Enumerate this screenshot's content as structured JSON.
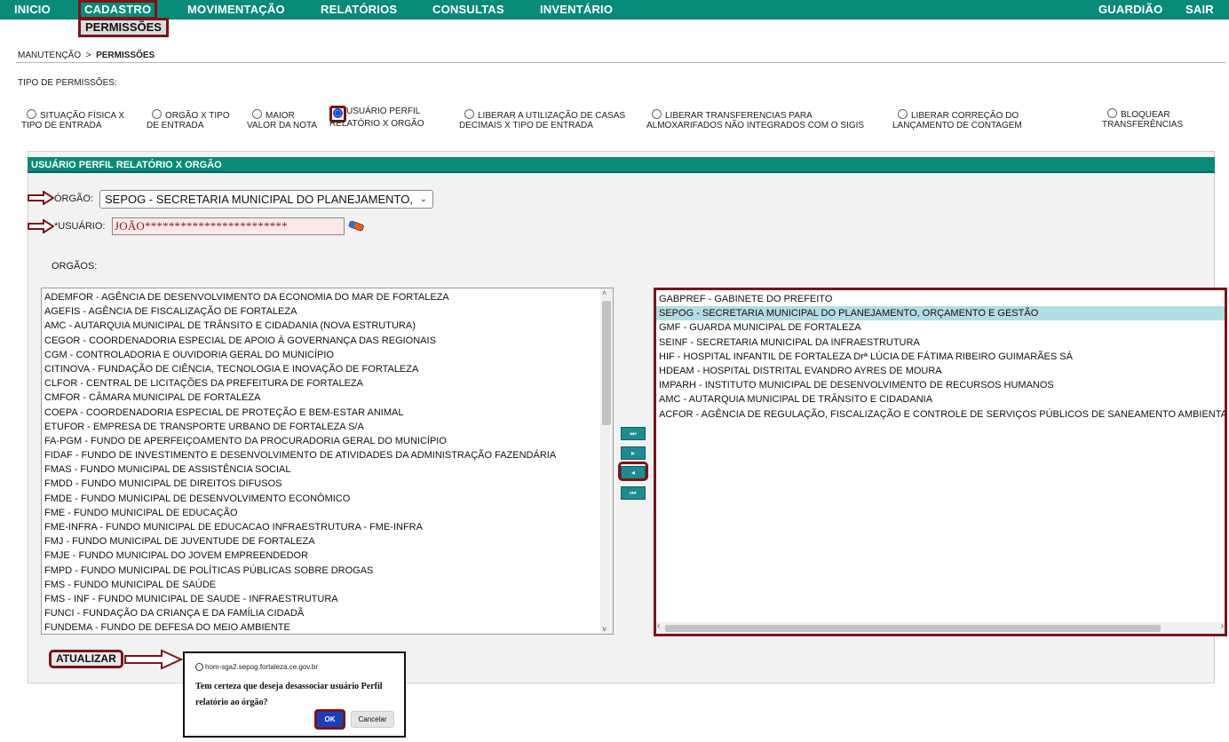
{
  "nav": {
    "items": [
      "INICIO",
      "CADASTRO",
      "MOVIMENTAÇÃO",
      "RELATÓRIOS",
      "CONSULTAS",
      "INVENTÁRIO"
    ],
    "right": [
      "GUARDIÃO",
      "SAIR"
    ],
    "submenu": "PERMISSÕES"
  },
  "breadcrumb": {
    "parent": "MANUTENÇÃO",
    "sep": ">",
    "current": "PERMISSÕES"
  },
  "permission_types_label": "TIPO DE PERMISSÕES:",
  "permission_types": [
    {
      "l1": "SITUAÇÃO FÍSICA X",
      "l2": "TIPO DE ENTRADA",
      "checked": false
    },
    {
      "l1": "ORGÃO X TIPO",
      "l2": "DE ENTRADA",
      "checked": false
    },
    {
      "l1": "MAIOR",
      "l2": "VALOR DA NOTA",
      "checked": false
    },
    {
      "l1": "USUÁRIO PERFIL",
      "l2": "RELATÓRIO X ORGÃO",
      "checked": true
    },
    {
      "l1": "LIBERAR A UTILIZAÇÃO DE CASAS",
      "l2": "DECIMAIS X TIPO DE ENTRADA",
      "checked": false
    },
    {
      "l1": "LIBERAR TRANSFERENCIAS PARA",
      "l2": "ALMOXARIFADOS NÃO INTEGRADOS COM O SIGIS",
      "checked": false
    },
    {
      "l1": "LIBERAR CORREÇÃO DO",
      "l2": "LANÇAMENTO DE CONTAGEM",
      "checked": false
    },
    {
      "l1": "BLOQUEAR",
      "l2": "TRANSFERÊNCIAS",
      "checked": false
    }
  ],
  "panel": {
    "title": "USUÁRIO PERFIL RELATÓRIO X ORGÃO",
    "orgao_label": "ÓRGÃO:",
    "orgao_value": "SEPOG - SECRETARIA MUNICIPAL DO PLANEJAMENTO,",
    "usuario_label": "*USUÁRIO:",
    "usuario_value": "JOÃO************************",
    "orgaos_label": "ORGÃOS:"
  },
  "available_orgaos": [
    "ADEMFOR - AGÊNCIA DE DESENVOLVIMENTO DA ECONOMIA DO MAR DE FORTALEZA",
    "AGEFIS - AGÊNCIA DE FISCALIZAÇÃO DE FORTALEZA",
    "AMC - AUTARQUIA MUNICIPAL DE TRÂNSITO E CIDADANIA (NOVA ESTRUTURA)",
    "CEGOR - COORDENADORIA ESPECIAL DE APOIO À GOVERNANÇA DAS REGIONAIS",
    "CGM - CONTROLADORIA E OUVIDORIA GERAL DO MUNICÍPIO",
    "CITINOVA - FUNDAÇÃO DE CIÊNCIA, TECNOLOGIA E INOVAÇÃO DE FORTALEZA",
    "CLFOR - CENTRAL DE LICITAÇÕES DA PREFEITURA DE FORTALEZA",
    "CMFOR - CÂMARA MUNICIPAL DE FORTALEZA",
    "COEPA - COORDENADORIA ESPECIAL DE PROTEÇÃO E BEM-ESTAR ANIMAL",
    "ETUFOR - EMPRESA DE TRANSPORTE URBANO DE FORTALEZA S/A",
    "FA-PGM - FUNDO DE APERFEIÇOAMENTO DA PROCURADORIA GERAL DO MUNICÍPIO",
    "FIDAF - FUNDO DE INVESTIMENTO E DESENVOLVIMENTO DE ATIVIDADES DA ADMINISTRAÇÃO FAZENDÁRIA",
    "FMAS - FUNDO MUNICIPAL DE ASSISTÊNCIA SOCIAL",
    "FMDD - FUNDO MUNICIPAL DE DIREITOS DIFUSOS",
    "FMDE - FUNDO MUNICIPAL DE DESENVOLVIMENTO ECONÔMICO",
    "FME - FUNDO MUNICIPAL DE EDUCAÇÃO",
    "FME-INFRA - FUNDO MUNICIPAL DE EDUCACAO INFRAESTRUTURA - FME-INFRA",
    "FMJ - FUNDO MUNICIPAL DE JUVENTUDE DE FORTALEZA",
    "FMJE - FUNDO MUNICIPAL DO JOVEM EMPREENDEDOR",
    "FMPD - FUNDO MUNICIPAL DE POLÍTICAS PÚBLICAS SOBRE DROGAS",
    "FMS - FUNDO MUNICIPAL DE SAÚDE",
    "FMS - INF - FUNDO MUNICIPAL DE SAUDE - INFRAESTRUTURA",
    "FUNCI - FUNDAÇÃO DA CRIANÇA E DA FAMÍLIA CIDADÃ",
    "FUNDEMA - FUNDO DE DEFESA DO MEIO AMBIENTE"
  ],
  "selected_orgaos": [
    "GABPREF - GABINETE DO PREFEITO",
    "SEPOG - SECRETARIA MUNICIPAL DO PLANEJAMENTO, ORÇAMENTO E GESTÃO",
    "GMF - GUARDA MUNICIPAL DE FORTALEZA",
    "SEINF - SECRETARIA MUNICIPAL DA INFRAESTRUTURA",
    "HIF - HOSPITAL INFANTIL DE FORTALEZA Drª LÚCIA DE FÁTIMA RIBEIRO GUIMARÃES SÁ",
    "HDEAM - HOSPITAL DISTRITAL EVANDRO AYRES DE MOURA",
    "IMPARH - INSTITUTO MUNICIPAL DE DESENVOLVIMENTO DE RECURSOS HUMANOS",
    "AMC - AUTARQUIA MUNICIPAL DE TRÂNSITO E CIDADANIA",
    "ACFOR - AGÊNCIA DE REGULAÇÃO, FISCALIZAÇÃO E CONTROLE DE SERVIÇOS PÚBLICOS DE SANEAMENTO AMBIENTAL"
  ],
  "selected_highlight_index": 1,
  "move_buttons": [
    "⏭",
    "▸",
    "◂",
    "⏮"
  ],
  "update_button": "ATUALIZAR",
  "dialog": {
    "host": "hom-sga2.sepog.fortaleza.ce.gov.br",
    "message": "Tem certeza que deseja desassociar usuário Perfil relatório ao órgão?",
    "ok": "OK",
    "cancel": "Cancelar"
  },
  "colors": {
    "nav_bg": "#0a8a78",
    "highlight_border": "#7a1518",
    "selected_row": "#b3dde2"
  }
}
